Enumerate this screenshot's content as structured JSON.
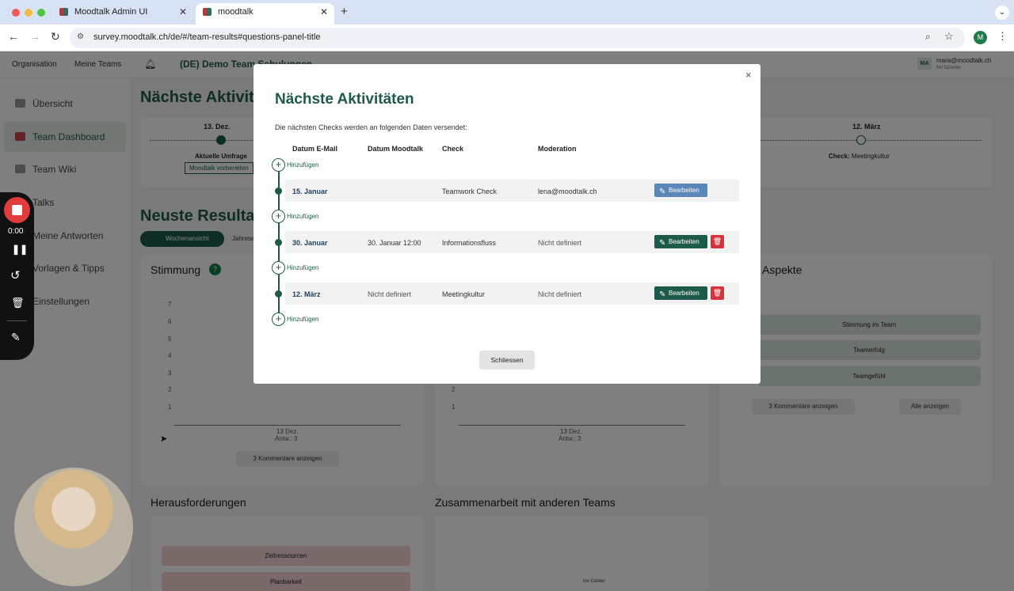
{
  "browser": {
    "tabs": [
      {
        "title": "Moodtalk Admin UI",
        "active": false
      },
      {
        "title": "moodtalk",
        "active": true
      }
    ],
    "url": "survey.moodtalk.ch/de/#/team-results#questions-panel-title",
    "profile_initial": "M"
  },
  "app": {
    "topnav": {
      "organisation": "Organisation",
      "teams": "Meine Teams",
      "team_selector": "(DE) Demo Team Schulungen",
      "user_initials": "MA",
      "user_email": "mara@moodtalk.ch",
      "user_org": "MoTaDeMo"
    },
    "sidebar": [
      {
        "label": "Übersicht"
      },
      {
        "label": "Team Dashboard"
      },
      {
        "label": "Team Wiki"
      },
      {
        "label": "Talks"
      },
      {
        "label": "Meine Antworten"
      },
      {
        "label": "Vorlagen & Tipps"
      },
      {
        "label": "Einstellungen"
      }
    ],
    "next_activities_title": "Nächste Aktivitäten",
    "timeline": {
      "first_date": "13. Dez.",
      "current_label": "Aktuelle Umfrage",
      "prepare_button": "Moodtalk vorbereiten",
      "last_date": "12. März",
      "last_check_prefix": "Check:",
      "last_check": "Meetingkultur"
    },
    "results_title": "Neuste Resultate",
    "view_tabs": [
      "Wochenansicht",
      "Jahresa"
    ],
    "stimmung_title": "Stimmung",
    "help": "?",
    "y_ticks": [
      "7",
      "6",
      "5",
      "4",
      "3",
      "2",
      "1"
    ],
    "chart_x_label": "13 Dez.",
    "chart_x_sub": "Antw.: 3",
    "comments_count": "3",
    "comments_button": "Kommentare anzeigen",
    "mid_y_ticks": [
      "2",
      "1"
    ],
    "aspects_title": "Aspekte",
    "aspects": [
      "Stimmung im Team",
      "Teamerfolg",
      "Teamgefühl"
    ],
    "all_button": "Alle anzeigen",
    "challenges_title": "Herausforderungen",
    "challenges": [
      "Zeitressourcen",
      "Planbarkeit"
    ],
    "collab_title": "Zusammenarbeit mit anderen Teams",
    "collab_point": "Inv Center"
  },
  "modal": {
    "title": "Nächste Aktivitäten",
    "subtitle": "Die nächsten Checks werden an folgenden Daten versendet:",
    "columns": [
      "Datum E-Mail",
      "Datum Moodtalk",
      "Check",
      "Moderation"
    ],
    "add_label": "Hinzufügen",
    "edit_label": "Bearbeiten",
    "rows": [
      {
        "date_email": "15. Januar",
        "date_moodtalk": "",
        "check": "Teamwork Check",
        "moderation": "lena@moodtalk.ch",
        "deletable": false
      },
      {
        "date_email": "30. Januar",
        "date_moodtalk": "30. Januar 12:00",
        "check": "Informationsfluss",
        "moderation": "Nicht definiert",
        "deletable": true
      },
      {
        "date_email": "12. März",
        "date_moodtalk": "Nicht definiert",
        "check": "Meetingkultur",
        "moderation": "Nicht definiert",
        "deletable": true
      }
    ],
    "close_button": "Schliessen"
  },
  "recorder": {
    "time": "0:00"
  },
  "colors": {
    "brand": "#1d5a4c",
    "edit_blue": "#5b86b8",
    "danger": "#d9323a"
  }
}
